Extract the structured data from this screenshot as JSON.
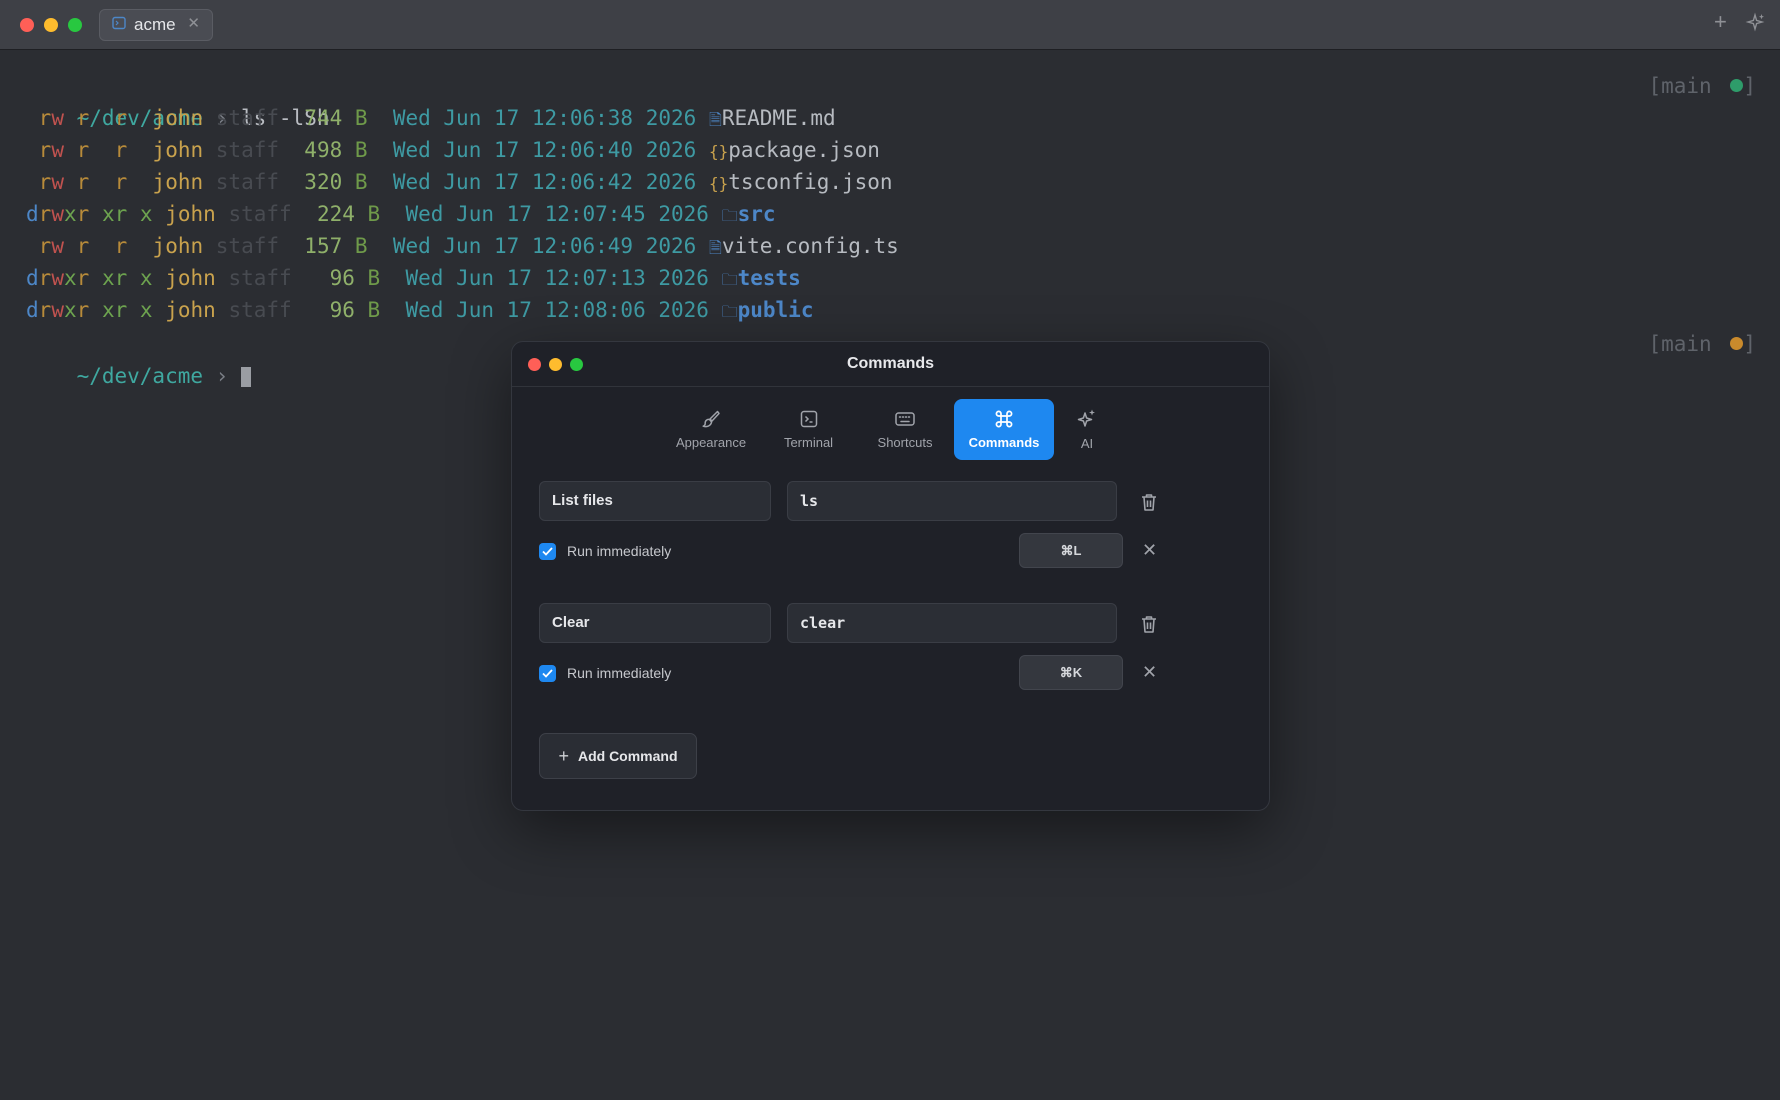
{
  "window": {
    "tab_title": "acme",
    "tab_icon": "terminal-icon",
    "new_tab_icon": "plus-icon",
    "ai_icon": "sparkles-icon"
  },
  "terminal": {
    "prompt_path": "~/dev/acme",
    "prompt_arrow": "›",
    "command": "ls -lSh",
    "branch_label": "[main",
    "branch_close": "]",
    "branch_dot_colors": [
      "#2e9c6a",
      "#c98a2c"
    ],
    "listing": [
      {
        "perms": [
          " ",
          "rw",
          "r",
          "r",
          " "
        ],
        "user": "john",
        "group": "staff",
        "size": "744",
        "unit": "B",
        "date": "Wed Jun 17 12:06:38 2026",
        "icon": "doc",
        "name": "README.md",
        "dir": false
      },
      {
        "perms": [
          " ",
          "rw",
          "r",
          "r",
          " "
        ],
        "user": "john",
        "group": "staff",
        "size": "498",
        "unit": "B",
        "date": "Wed Jun 17 12:06:40 2026",
        "icon": "brace",
        "name": "package.json",
        "dir": false
      },
      {
        "perms": [
          " ",
          "rw",
          "r",
          "r",
          " "
        ],
        "user": "john",
        "group": "staff",
        "size": "320",
        "unit": "B",
        "date": "Wed Jun 17 12:06:42 2026",
        "icon": "brace",
        "name": "tsconfig.json",
        "dir": false
      },
      {
        "perms": [
          "d",
          "rwx",
          "r x",
          "r x",
          ""
        ],
        "user": "john",
        "group": "staff",
        "size": "224",
        "unit": "B",
        "date": "Wed Jun 17 12:07:45 2026",
        "icon": "folder",
        "name": "src",
        "dir": true
      },
      {
        "perms": [
          " ",
          "rw",
          "r",
          "r",
          " "
        ],
        "user": "john",
        "group": "staff",
        "size": "157",
        "unit": "B",
        "date": "Wed Jun 17 12:06:49 2026",
        "icon": "doc",
        "name": "vite.config.ts",
        "dir": false
      },
      {
        "perms": [
          "d",
          "rwx",
          "r x",
          "r x",
          ""
        ],
        "user": "john",
        "group": "staff",
        "size": " 96",
        "unit": "B",
        "date": "Wed Jun 17 12:07:13 2026",
        "icon": "folder",
        "name": "tests",
        "dir": true
      },
      {
        "perms": [
          "d",
          "rwx",
          "r x",
          "r x",
          ""
        ],
        "user": "john",
        "group": "staff",
        "size": " 96",
        "unit": "B",
        "date": "Wed Jun 17 12:08:06 2026",
        "icon": "folder",
        "name": "public",
        "dir": true
      }
    ]
  },
  "dialog": {
    "title": "Commands",
    "tabs": [
      {
        "label": "Appearance",
        "icon": "brush-icon"
      },
      {
        "label": "Terminal",
        "icon": "terminal-icon"
      },
      {
        "label": "Shortcuts",
        "icon": "keyboard-icon"
      },
      {
        "label": "Commands",
        "icon": "command-icon",
        "active": true
      },
      {
        "label": "AI",
        "icon": "sparkles-icon"
      }
    ],
    "commands": [
      {
        "name": "List files",
        "command": "ls",
        "run_label": "Run immediately",
        "run_checked": true,
        "shortcut": "⌘L"
      },
      {
        "name": "Clear",
        "command": "clear",
        "run_label": "Run immediately",
        "run_checked": true,
        "shortcut": "⌘K"
      }
    ],
    "add_label": "Add Command",
    "accent": "#1e88f0"
  }
}
